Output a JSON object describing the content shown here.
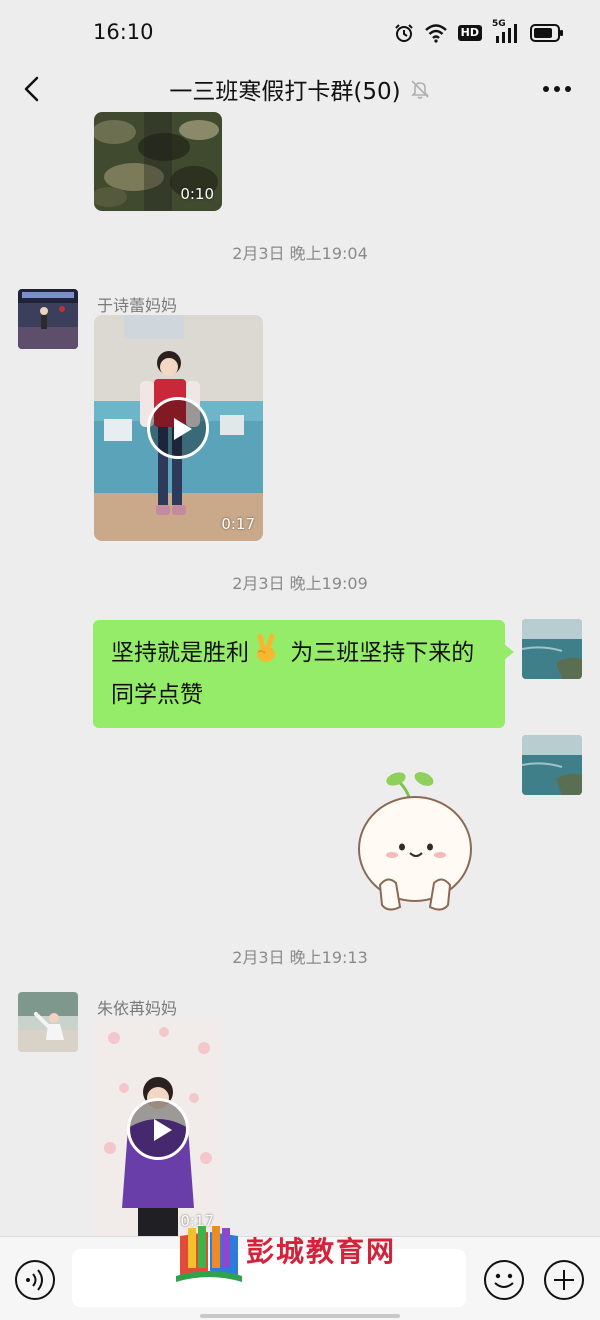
{
  "status_bar": {
    "time": "16:10",
    "hd": "HD",
    "network": "5G"
  },
  "header": {
    "title": "一三班寒假打卡群(50)"
  },
  "messages": [
    {
      "type": "video",
      "duration": "0:10"
    },
    {
      "type": "timestamp",
      "text": "2月3日 晚上19:04"
    },
    {
      "type": "video",
      "sender": "于诗蕾妈妈",
      "duration": "0:17"
    },
    {
      "type": "timestamp",
      "text": "2月3日 晚上19:09"
    },
    {
      "type": "text",
      "part1": "坚持就是胜利",
      "emoji": "✌",
      "part2": " 为三班坚持下来的同学点赞"
    },
    {
      "type": "sticker"
    },
    {
      "type": "timestamp",
      "text": "2月3日 晚上19:13"
    },
    {
      "type": "video",
      "sender": "朱依苒妈妈",
      "duration": "0:17"
    }
  ],
  "input": {
    "placeholder": ""
  },
  "watermark": {
    "text": "彭城教育网"
  },
  "colors": {
    "background": "#ededed",
    "bubble_out": "#95ec69",
    "watermark": "#d6213a"
  },
  "icons": [
    "back-icon",
    "mute-bell-icon",
    "more-icon",
    "voice-icon",
    "emoji-icon",
    "plus-icon",
    "alarm-icon",
    "wifi-icon",
    "signal-icon",
    "battery-icon"
  ]
}
